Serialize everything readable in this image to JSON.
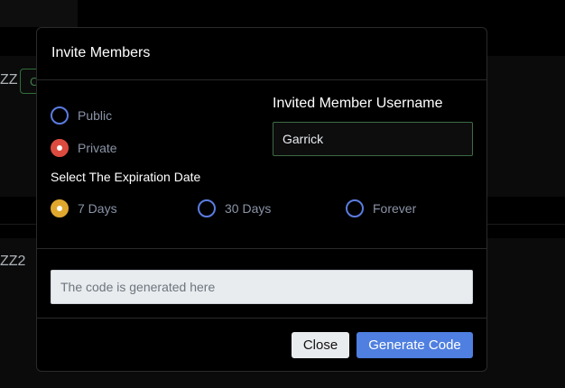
{
  "background": {
    "row1_label": "ZZ",
    "row1_chip": "C",
    "row2_label": "ZZ2"
  },
  "modal": {
    "title": "Invite Members",
    "visibility": {
      "options": [
        {
          "label": "Public",
          "checked": false
        },
        {
          "label": "Private",
          "checked": true
        }
      ]
    },
    "expiration": {
      "label": "Select The Expiration Date",
      "options": [
        {
          "label": "7 Days",
          "checked": true
        },
        {
          "label": "30 Days",
          "checked": false
        },
        {
          "label": "Forever",
          "checked": false
        }
      ]
    },
    "username": {
      "label": "Invited Member Username",
      "value": "Garrick"
    },
    "code": {
      "placeholder": "The code is generated here",
      "value": ""
    },
    "buttons": {
      "close": "Close",
      "generate": "Generate Code"
    }
  },
  "colors": {
    "accent": "#4f7fe0",
    "private_checked": "#dc4b3f",
    "expiration_checked": "#e0a72e",
    "radio_border": "#5b7ce0"
  }
}
